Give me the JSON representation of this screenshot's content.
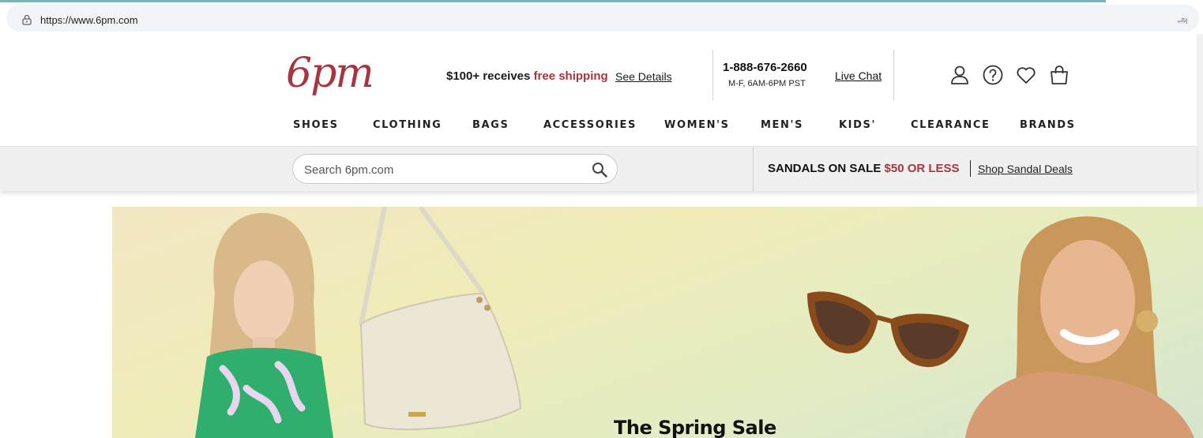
{
  "browser": {
    "url": "https://www.6pm.com",
    "translate_glyph": "அ"
  },
  "header": {
    "logo": "6pm",
    "shipping_prefix": "$100+ receives ",
    "shipping_highlight": "free shipping",
    "see_details": "See Details",
    "phone": "1-888-676-2660",
    "hours": "M-F, 6AM-6PM PST",
    "live_chat": "Live Chat",
    "icons": [
      "account-icon",
      "help-icon",
      "favorites-icon",
      "cart-icon"
    ]
  },
  "nav": {
    "items": [
      "SHOES",
      "CLOTHING",
      "BAGS",
      "ACCESSORIES",
      "WOMEN'S",
      "MEN'S",
      "KIDS'",
      "CLEARANCE",
      "BRANDS"
    ]
  },
  "subbar": {
    "search_placeholder": "Search 6pm.com",
    "promo_prefix": "SANDALS ON SALE ",
    "promo_highlight": "$50 OR LESS",
    "promo_link": "Shop Sandal Deals"
  },
  "hero": {
    "title": "The Spring Sale"
  },
  "colors": {
    "brand_red": "#a8343f",
    "subbar_bg": "#f0f0f0"
  }
}
